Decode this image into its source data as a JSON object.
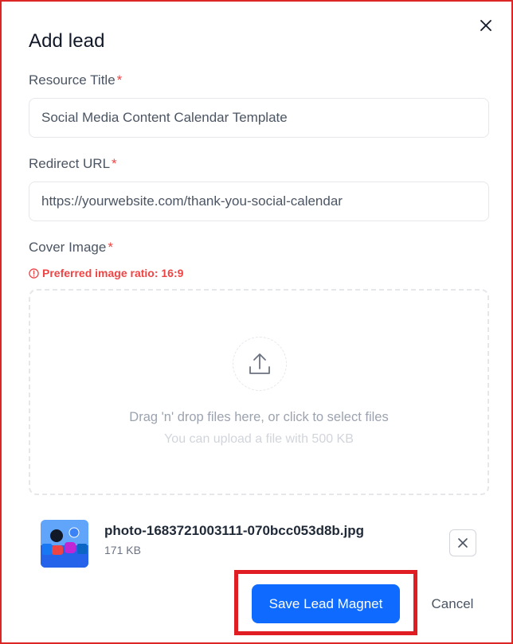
{
  "dialog": {
    "title": "Add lead",
    "close_icon": "close-icon"
  },
  "fields": {
    "resource_title": {
      "label": "Resource Title",
      "required_mark": "*",
      "value": "Social Media Content Calendar Template"
    },
    "redirect_url": {
      "label": "Redirect URL",
      "required_mark": "*",
      "value": "https://yourwebsite.com/thank-you-social-calendar"
    },
    "cover_image": {
      "label": "Cover Image",
      "required_mark": "*",
      "hint": "Preferred image ratio: 16:9",
      "hint_icon": "info-icon"
    }
  },
  "dropzone": {
    "icon": "upload-icon",
    "text": "Drag 'n' drop files here, or click to select files",
    "subtext": "You can upload a file with 500 KB"
  },
  "uploaded_file": {
    "name": "photo-1683721003111-070bcc053d8b.jpg",
    "size": "171 KB",
    "remove_icon": "close-icon"
  },
  "actions": {
    "save_label": "Save Lead Magnet",
    "cancel_label": "Cancel"
  },
  "colors": {
    "primary": "#0f6bff",
    "required": "#ef4444",
    "highlight": "#e11d24"
  }
}
